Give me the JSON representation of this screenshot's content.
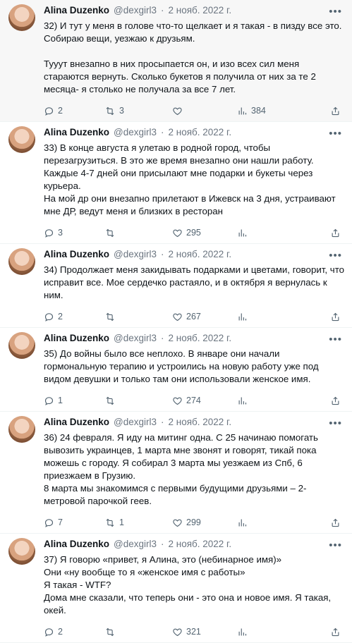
{
  "colors": {
    "text": "#0f1419",
    "muted": "#536471",
    "highlight_bg": "#f7f7f7",
    "divider": "#eff3f4"
  },
  "icons": [
    "reply-icon",
    "retweet-icon",
    "like-icon",
    "views-icon",
    "share-icon",
    "more-icon"
  ],
  "tweets": [
    {
      "name": "Alina Duzenko",
      "handle": "@dexgirl3",
      "dot": "·",
      "date": "2 нояб. 2022 г.",
      "paragraphs": [
        "32) И тут у меня в голове что-то щелкает и я такая - в пизду все это. Собираю вещи, уезжаю к друзьям.",
        "",
        "Тууут внезапно в них просыпается он, и изо всех сил меня стараются вернуть. Сколько букетов я получила от них за те 2 месяца- я столько не получала за все 7 лет."
      ],
      "replies": "2",
      "retweets": "3",
      "likes": "",
      "views": "384"
    },
    {
      "name": "Alina Duzenko",
      "handle": "@dexgirl3",
      "dot": "·",
      "date": "2 нояб. 2022 г.",
      "paragraphs": [
        "33) В конце августа я улетаю в родной город, чтобы перезагрузиться. В это же время внезапно они нашли работу.",
        "Каждые 4-7 дней они присылают мне подарки и букеты через курьера.",
        "На мой др они внезапно прилетают в Ижевск на 3 дня, устраивают мне ДР, ведут меня и близких в ресторан"
      ],
      "replies": "3",
      "retweets": "",
      "likes": "295",
      "views": ""
    },
    {
      "name": "Alina Duzenko",
      "handle": "@dexgirl3",
      "dot": "·",
      "date": "2 нояб. 2022 г.",
      "paragraphs": [
        "34) Продолжает меня закидывать подарками и цветами, говорит, что исправит все. Мое сердечко растаяло, и в октября я вернулась к ним."
      ],
      "replies": "2",
      "retweets": "",
      "likes": "267",
      "views": ""
    },
    {
      "name": "Alina Duzenko",
      "handle": "@dexgirl3",
      "dot": "·",
      "date": "2 нояб. 2022 г.",
      "paragraphs": [
        "35) До войны было все неплохо. В январе они начали гормональную терапию и устроились на новую работу уже под видом девушки и только там они использовали женское имя."
      ],
      "replies": "1",
      "retweets": "",
      "likes": "274",
      "views": ""
    },
    {
      "name": "Alina Duzenko",
      "handle": "@dexgirl3",
      "dot": "·",
      "date": "2 нояб. 2022 г.",
      "paragraphs": [
        "36) 24 февраля. Я иду на митинг одна. С 25 начинаю помогать вывозить украинцев, 1 марта мне звонят и говорят, тикай пока можешь с городу. Я собирал 3 марта мы уезжаем из Спб, 6 приезжаем в Грузию.",
        "8 марта мы знакомимся с первыми будущими друзьями – 2-метровой парочкой геев."
      ],
      "replies": "7",
      "retweets": "1",
      "likes": "299",
      "views": ""
    },
    {
      "name": "Alina Duzenko",
      "handle": "@dexgirl3",
      "dot": "·",
      "date": "2 нояб. 2022 г.",
      "paragraphs": [
        "37) Я говорю «привет, я Алина, это (небинарное имя)»",
        "Они «ну вообще то я «женское имя с работы»",
        "Я такая - WTF?",
        "Дома мне сказали, что теперь они - это она и новое имя. Я такая, окей."
      ],
      "replies": "2",
      "retweets": "",
      "likes": "321",
      "views": ""
    }
  ]
}
